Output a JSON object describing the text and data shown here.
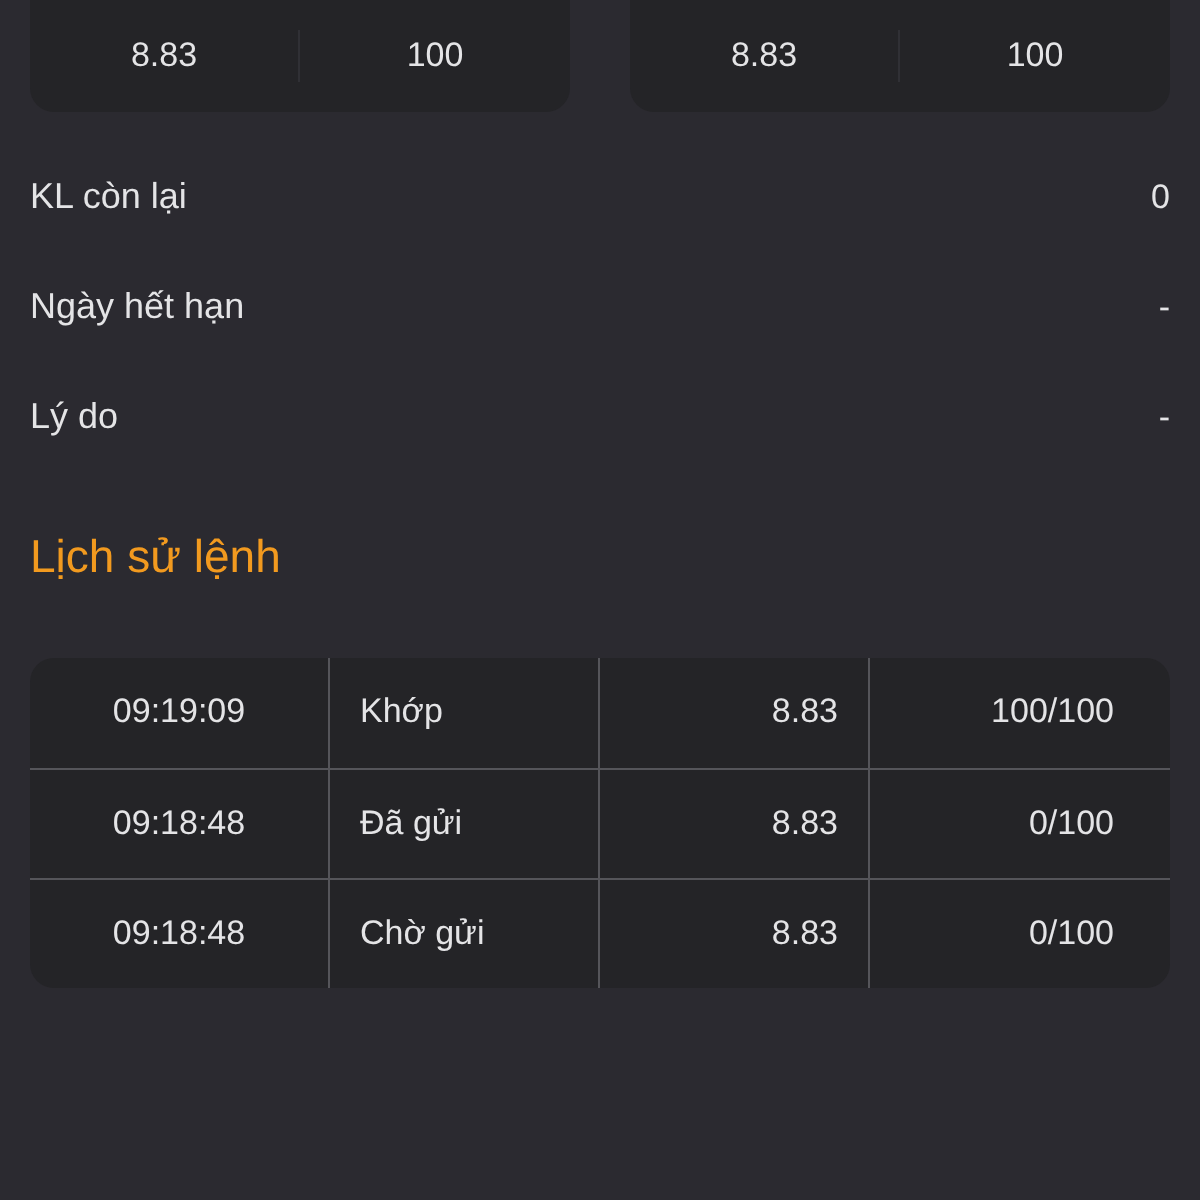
{
  "order_cards": [
    {
      "price": "8.83",
      "quantity": "100"
    },
    {
      "price": "8.83",
      "quantity": "100"
    }
  ],
  "details": [
    {
      "label": "KL còn lại",
      "value": "0"
    },
    {
      "label": "Ngày hết hạn",
      "value": "-"
    },
    {
      "label": "Lý do",
      "value": "-"
    }
  ],
  "history": {
    "title": "Lịch sử lệnh",
    "rows": [
      {
        "time": "09:19:09",
        "status": "Khớp",
        "price": "8.83",
        "filled": "100/100"
      },
      {
        "time": "09:18:48",
        "status": "Đã gửi",
        "price": "8.83",
        "filled": "0/100"
      },
      {
        "time": "09:18:48",
        "status": "Chờ gửi",
        "price": "8.83",
        "filled": "0/100"
      }
    ]
  }
}
